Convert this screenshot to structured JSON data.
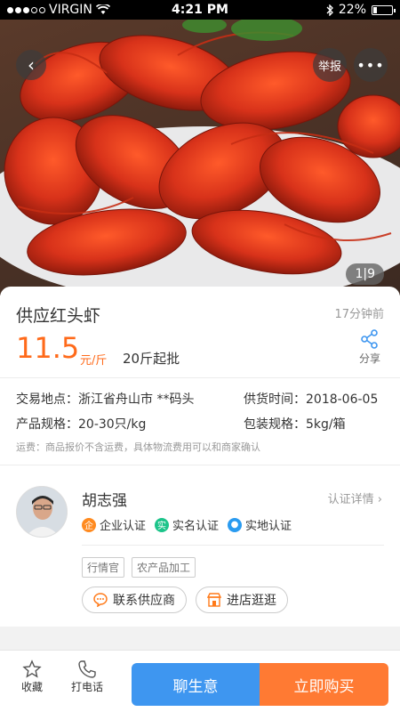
{
  "status_bar": {
    "carrier": "VIRGIN",
    "time": "4:21 PM",
    "battery": "22%",
    "battery_level": 0.22
  },
  "hero": {
    "counter": "1|9",
    "report_label": "举报",
    "more_label": "•••"
  },
  "product": {
    "title": "供应红头虾",
    "time_ago": "17分钟前",
    "price": "11.5",
    "unit": "元/斤",
    "moq": "20斤起批",
    "share_label": "分享",
    "location_label": "交易地点：",
    "location_value": "浙江省舟山市 **码头",
    "supply_time_label": "供货时间：",
    "supply_time_value": "2018-06-05",
    "spec_label": "产品规格：",
    "spec_value": "20-30只/kg",
    "pack_label": "包装规格：",
    "pack_value": "5kg/箱",
    "shipping_note": "运费：商品报价不含运费，具体物流费用可以和商家确认"
  },
  "seller": {
    "name": "胡志强",
    "verify_link": "认证详情",
    "badges": [
      {
        "label": "企业认证",
        "color": "#ff8a1f",
        "glyph": "企"
      },
      {
        "label": "实名认证",
        "color": "#1cc48a",
        "glyph": "实"
      },
      {
        "label": "实地认证",
        "color": "#2a9bf0",
        "glyph": "●"
      }
    ],
    "tags": [
      "行情官",
      "农产品加工"
    ],
    "contact_label": "联系供应商",
    "store_label": "进店逛逛"
  },
  "bottom_bar": {
    "favorite_label": "收藏",
    "call_label": "打电话",
    "chat_label": "聊生意",
    "buy_label": "立即购买"
  },
  "colors": {
    "price": "#ff6a1a",
    "chat": "#3e96f0",
    "buy": "#ff7a33"
  }
}
